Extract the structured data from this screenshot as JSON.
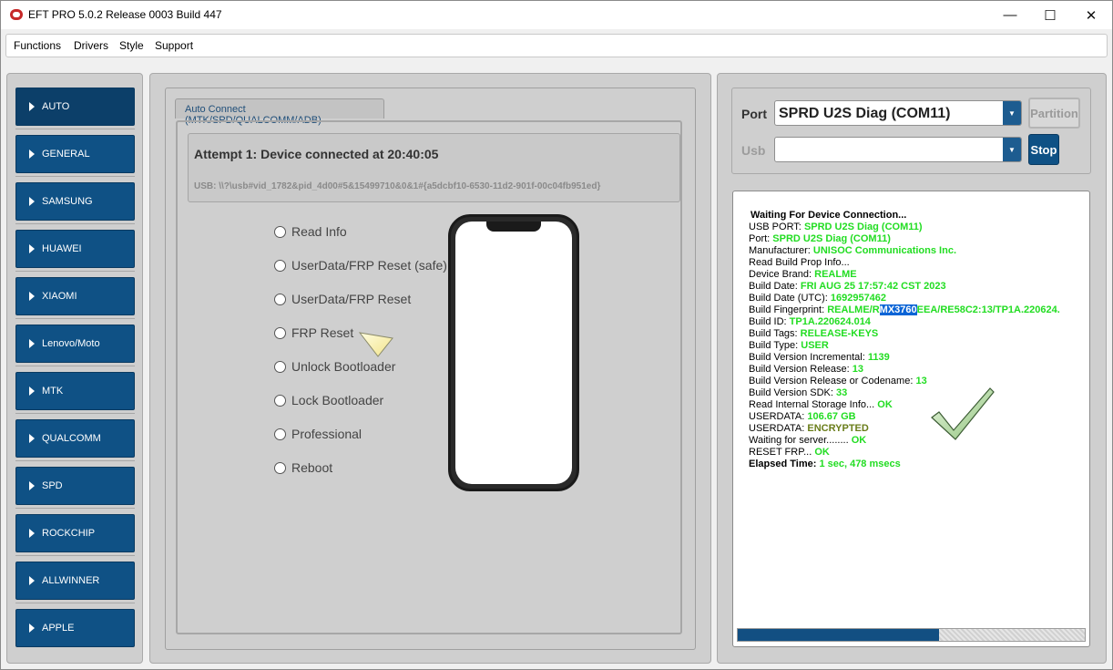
{
  "window": {
    "title": "EFT PRO 5.0.2 Release 0003 Build 447",
    "controls": {
      "minimize": "—",
      "maximize": "☐",
      "close": "✕"
    }
  },
  "menu": [
    "Functions",
    "Drivers",
    "Style",
    "Support"
  ],
  "sidebar": {
    "items": [
      "AUTO",
      "GENERAL",
      "SAMSUNG",
      "HUAWEI",
      "XIAOMI",
      "Lenovo/Moto",
      "MTK",
      "QUALCOMM",
      "SPD",
      "ROCKCHIP",
      "ALLWINNER",
      "APPLE"
    ],
    "active": "AUTO"
  },
  "main": {
    "tab_label": "Auto Connect (MTK/SPD/QUALCOMM/ADB)",
    "attempt_text": "Attempt 1: Device connected at 20:40:05",
    "usb_text": "USB: \\\\?\\usb#vid_1782&pid_4d00#5&15499710&0&1#{a5dcbf10-6530-11d2-901f-00c04fb951ed}",
    "options": [
      "Read Info",
      "UserData/FRP Reset (safe)",
      "UserData/FRP Reset",
      "FRP Reset",
      "Unlock Bootloader",
      "Lock Bootloader",
      "Professional",
      "Reboot"
    ]
  },
  "port_panel": {
    "port_label": "Port",
    "port_value": "SPRD U2S Diag (COM11)",
    "usb_label": "Usb",
    "usb_value": "",
    "partition_button": "Partition",
    "stop_button": "Stop"
  },
  "log": {
    "lines": [
      {
        "label": "Waiting For Device Connection...",
        "value": ""
      },
      {
        "label": "USB PORT: ",
        "value": "SPRD U2S Diag (COM11)"
      },
      {
        "label": "Port: ",
        "value": "SPRD U2S Diag (COM11)"
      },
      {
        "label": "Manufacturer: ",
        "value": "UNISOC Communications Inc."
      },
      {
        "label": "Read Build Prop Info...",
        "value": ""
      },
      {
        "label": " Device Brand: ",
        "value": "REALME"
      },
      {
        "label": " Build Date: ",
        "value": "FRI AUG 25 17:57:42 CST 2023"
      },
      {
        "label": " Build Date (UTC): ",
        "value": "1692957462"
      },
      {
        "label": " Build Fingerprint: ",
        "value_pre": "REALME/R",
        "value_sel": "MX3760",
        "value_post": "EEA/RE58C2:13/TP1A.220624."
      },
      {
        "label": " Build ID: ",
        "value": "TP1A.220624.014"
      },
      {
        "label": " Build Tags: ",
        "value": "RELEASE-KEYS"
      },
      {
        "label": " Build Type: ",
        "value": "USER"
      },
      {
        "label": " Build Version Incremental: ",
        "value": "1139"
      },
      {
        "label": " Build Version Release: ",
        "value": "13"
      },
      {
        "label": " Build Version Release or Codename: ",
        "value": "13"
      },
      {
        "label": " Build Version SDK: ",
        "value": "33"
      },
      {
        "label": "Read Internal Storage Info... ",
        "value": "OK"
      },
      {
        "label": "USERDATA: ",
        "value": "106.67 GB"
      },
      {
        "label": "USERDATA: ",
        "value": "ENCRYPTED"
      },
      {
        "label": "Waiting for server........ ",
        "value": "OK"
      },
      {
        "label": "RESET FRP... ",
        "value": "OK"
      },
      {
        "label": "Elapsed Time: ",
        "value": "1 sec, 478 msecs"
      }
    ],
    "progress": 0.58
  },
  "colors": {
    "accent_blue": "#0f5185",
    "ok_green": "#22dd22",
    "encrypted_olive": "#6a7d1a"
  }
}
